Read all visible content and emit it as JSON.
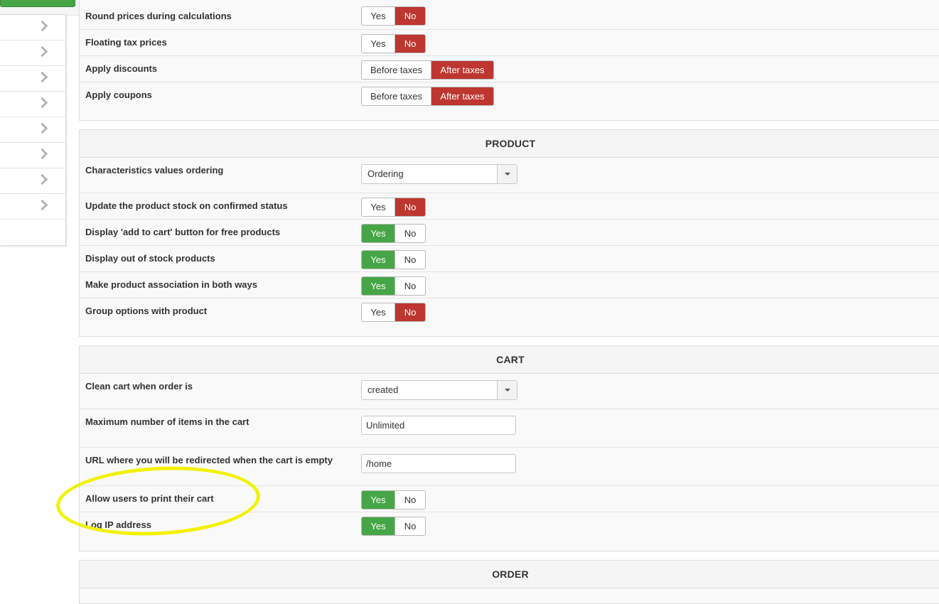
{
  "colors": {
    "active_no": "#bd362f",
    "active_yes": "#46a546",
    "highlight": "#f2f200"
  },
  "sidebar": {
    "icon": "chevron-right-icon",
    "item_count": 8
  },
  "tax_section": {
    "partial_label": "Round prices during calculations",
    "rows": [
      {
        "label": "Floating tax prices",
        "options": [
          "Yes",
          "No"
        ],
        "selected": "No"
      },
      {
        "label": "Apply discounts",
        "options": [
          "Before taxes",
          "After taxes"
        ],
        "selected": "After taxes"
      },
      {
        "label": "Apply coupons",
        "options": [
          "Before taxes",
          "After taxes"
        ],
        "selected": "After taxes"
      }
    ],
    "partial_options": [
      "Yes",
      "No"
    ]
  },
  "product_section": {
    "title": "PRODUCT",
    "characteristics": {
      "label": "Characteristics values ordering",
      "value": "Ordering"
    },
    "rows": [
      {
        "label": "Update the product stock on confirmed status",
        "options": [
          "Yes",
          "No"
        ],
        "selected": "No"
      },
      {
        "label": "Display 'add to cart' button for free products",
        "options": [
          "Yes",
          "No"
        ],
        "selected": "Yes"
      },
      {
        "label": "Display out of stock products",
        "options": [
          "Yes",
          "No"
        ],
        "selected": "Yes"
      },
      {
        "label": "Make product association in both ways",
        "options": [
          "Yes",
          "No"
        ],
        "selected": "Yes"
      },
      {
        "label": "Group options with product",
        "options": [
          "Yes",
          "No"
        ],
        "selected": "No"
      }
    ]
  },
  "cart_section": {
    "title": "CART",
    "clean_cart": {
      "label": "Clean cart when order is",
      "value": "created"
    },
    "max_items": {
      "label": "Maximum number of items in the cart",
      "value": "Unlimited"
    },
    "redirect_url": {
      "label": "URL where you will be redirected when the cart is empty",
      "value": "/home"
    },
    "rows": [
      {
        "label": "Allow users to print their cart",
        "options": [
          "Yes",
          "No"
        ],
        "selected": "Yes"
      },
      {
        "label": "Log IP address",
        "options": [
          "Yes",
          "No"
        ],
        "selected": "Yes"
      }
    ]
  },
  "order_section": {
    "title": "ORDER"
  }
}
